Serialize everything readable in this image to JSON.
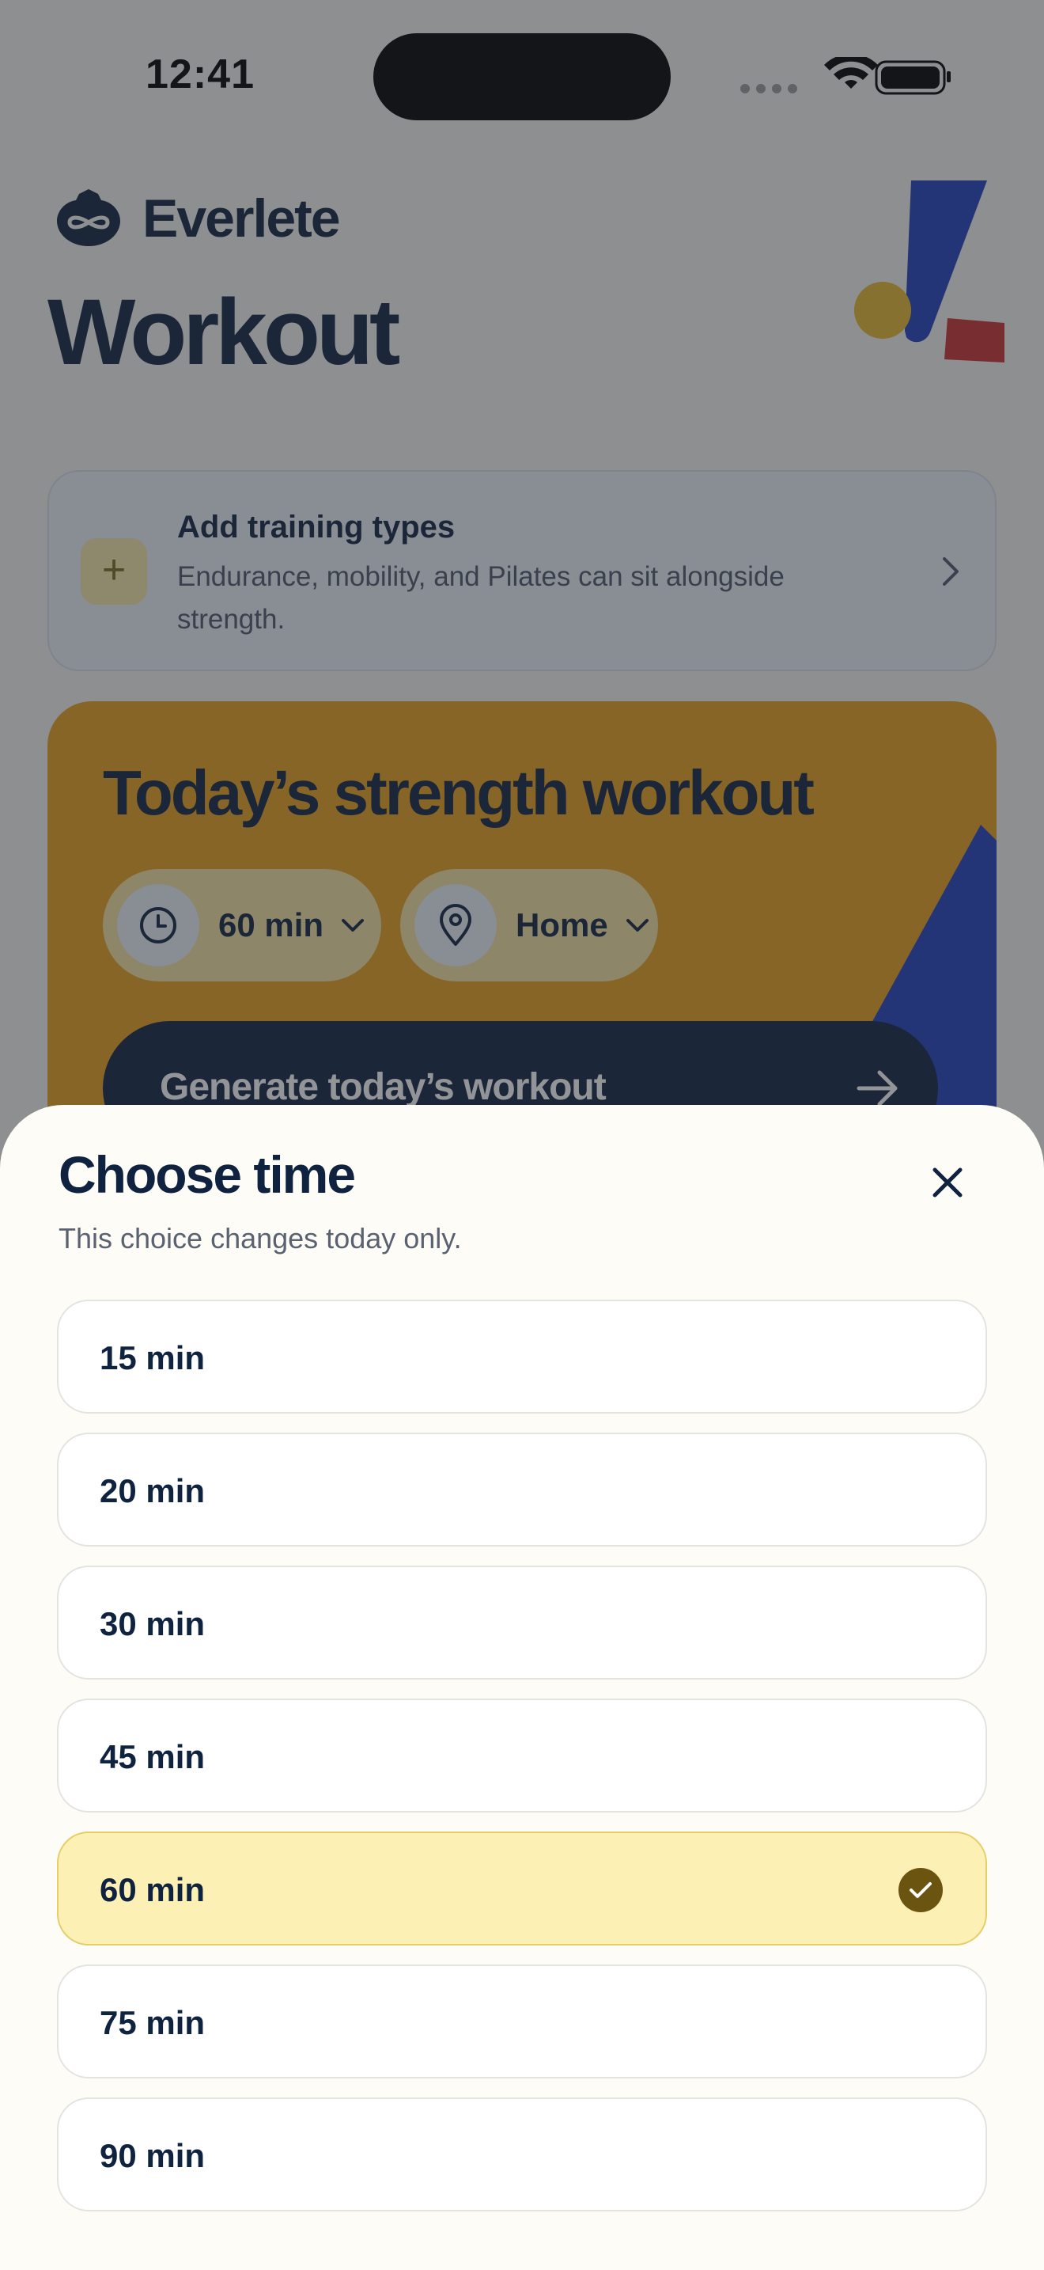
{
  "status_bar": {
    "time": "12:41"
  },
  "brand": {
    "name": "Everlete",
    "logo_icon": "owl-infinity-logo"
  },
  "page_title": "Workout",
  "add_training": {
    "icon": "plus-icon",
    "icon_glyph": "+",
    "title": "Add training types",
    "description": "Endurance, mobility, and Pilates can sit alongside strength."
  },
  "strength_card": {
    "title": "Today’s strength workout",
    "time_pill": {
      "icon": "clock-icon",
      "label": "60 min"
    },
    "place_pill": {
      "icon": "location-pin-icon",
      "label": "Home"
    },
    "generate_button": {
      "label": "Generate today’s workout",
      "icon": "arrow-right-icon"
    }
  },
  "sheet": {
    "title": "Choose time",
    "subtitle": "This choice changes today only.",
    "close_icon": "close-icon",
    "selected_value": "60 min",
    "options": [
      {
        "label": "15 min",
        "selected": false
      },
      {
        "label": "20 min",
        "selected": false
      },
      {
        "label": "30 min",
        "selected": false
      },
      {
        "label": "45 min",
        "selected": false
      },
      {
        "label": "60 min",
        "selected": true
      },
      {
        "label": "75 min",
        "selected": false
      },
      {
        "label": "90 min",
        "selected": false
      }
    ]
  },
  "colors": {
    "navy": "#0f2340",
    "accent_yellow": "#e6a11f",
    "accent_blue": "#1f3fbf",
    "accent_red": "#c83232",
    "selected_bg": "#fdf0b4",
    "check_bg": "#6b5410"
  }
}
